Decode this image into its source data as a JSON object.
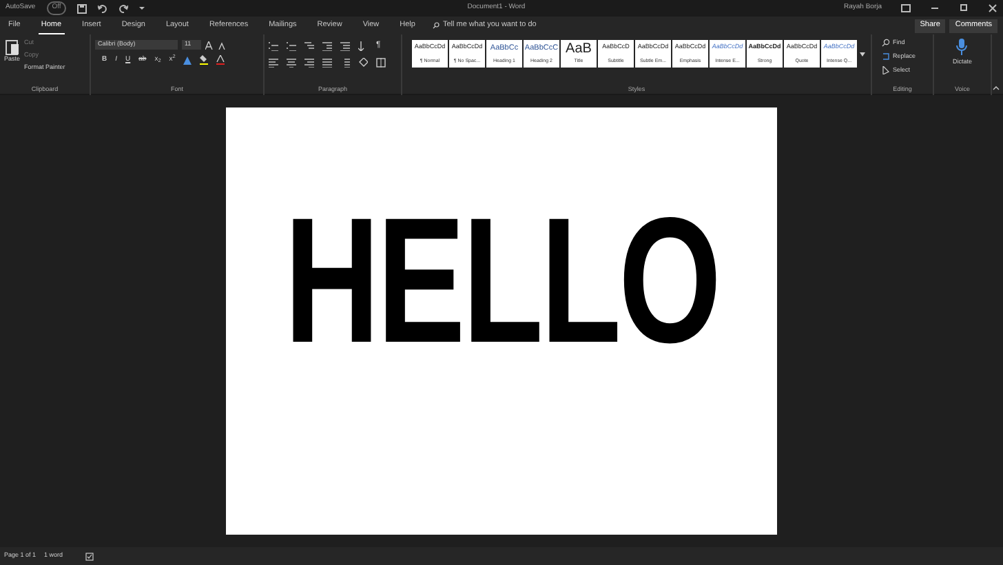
{
  "title_bar": {
    "autosave_label": "AutoSave",
    "autosave_toggle": "Off",
    "autosave_on": false,
    "title": "Document1 - Word",
    "user": "Rayah Borja"
  },
  "tabs": [
    {
      "label": "File",
      "selected": false
    },
    {
      "label": "Home",
      "selected": true
    },
    {
      "label": "Insert",
      "selected": false
    },
    {
      "label": "Design",
      "selected": false
    },
    {
      "label": "Layout",
      "selected": false
    },
    {
      "label": "References",
      "selected": false
    },
    {
      "label": "Mailings",
      "selected": false
    },
    {
      "label": "Review",
      "selected": false
    },
    {
      "label": "View",
      "selected": false
    },
    {
      "label": "Help",
      "selected": false
    }
  ],
  "tell_me": {
    "placeholder": "Tell me what you want to do"
  },
  "share": "Share",
  "comments": "Comments",
  "clipboard": {
    "paste": "Paste",
    "cut": "Cut",
    "copy": "Copy",
    "format_painter": "Format Painter",
    "label": "Clipboard"
  },
  "font": {
    "name": "Calibri (Body)",
    "size": "11",
    "buttons": [
      "B",
      "I",
      "U",
      "ab",
      "x$_{2}$",
      "x$^{2}$"
    ],
    "label": "Font"
  },
  "paragraph": {
    "label": "Paragraph",
    "pilcrow": "¶"
  },
  "styles": {
    "label": "Styles",
    "items": [
      {
        "preview": "AaBbCcDd",
        "name": "¶ Normal",
        "kind": "body"
      },
      {
        "preview": "AaBbCcDd",
        "name": "¶ No Spac...",
        "kind": "body"
      },
      {
        "preview": "AaBbCc",
        "name": "Heading 1",
        "kind": "heading"
      },
      {
        "preview": "AaBbCcC",
        "name": "Heading 2",
        "kind": "heading"
      },
      {
        "preview": "AaB",
        "name": "Title",
        "kind": "title"
      },
      {
        "preview": "AaBbCcD",
        "name": "Subtitle",
        "kind": "body"
      },
      {
        "preview": "AaBbCcDd",
        "name": "Subtle Em...",
        "kind": "body"
      },
      {
        "preview": "AaBbCcDd",
        "name": "Emphasis",
        "kind": "body"
      },
      {
        "preview": "AaBbCcDd",
        "name": "Intense E...",
        "kind": "accent"
      },
      {
        "preview": "AaBbCcDd",
        "name": "Strong",
        "kind": "strong"
      },
      {
        "preview": "AaBbCcDd",
        "name": "Quote",
        "kind": "body"
      },
      {
        "preview": "AaBbCcDd",
        "name": "Intense Q...",
        "kind": "accent"
      }
    ]
  },
  "editing": {
    "find": "Find",
    "replace": "Replace",
    "select": "Select",
    "label": "Editing"
  },
  "voice": {
    "dictate": "Dictate",
    "label": "Voice"
  },
  "document": {
    "text": "HELLO"
  },
  "status_bar": {
    "page": "Page 1 of 1",
    "words": "1 word"
  }
}
